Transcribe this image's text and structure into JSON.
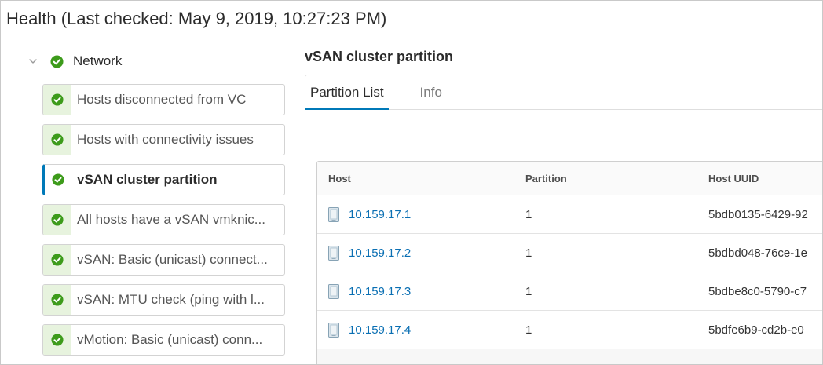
{
  "header": {
    "title": "Health (Last checked: May 9, 2019, 10:27:23 PM)"
  },
  "colors": {
    "accent": "#0079b8",
    "success": "#3d9b1b",
    "success_bg": "#e7f3de",
    "link": "#0a6fb3"
  },
  "tree": {
    "group": {
      "label": "Network",
      "expanded": true,
      "expand_icon": "chevron-down-icon",
      "status_icon": "check-circle-icon"
    },
    "items": [
      {
        "label": "Hosts disconnected from VC",
        "status_icon": "check-circle-icon",
        "selected": false
      },
      {
        "label": "Hosts with connectivity issues",
        "status_icon": "check-circle-icon",
        "selected": false
      },
      {
        "label": "vSAN cluster partition",
        "status_icon": "check-circle-icon",
        "selected": true
      },
      {
        "label": "All hosts have a vSAN vmknic...",
        "status_icon": "check-circle-icon",
        "selected": false
      },
      {
        "label": "vSAN: Basic (unicast) connect...",
        "status_icon": "check-circle-icon",
        "selected": false
      },
      {
        "label": "vSAN: MTU check (ping with l...",
        "status_icon": "check-circle-icon",
        "selected": false
      },
      {
        "label": "vMotion: Basic (unicast) conn...",
        "status_icon": "check-circle-icon",
        "selected": false
      }
    ]
  },
  "detail": {
    "title": "vSAN cluster partition",
    "tabs": [
      {
        "label": "Partition List",
        "active": true
      },
      {
        "label": "Info",
        "active": false
      }
    ],
    "table": {
      "columns": [
        "Host",
        "Partition",
        "Host UUID"
      ],
      "host_icon": "server-icon",
      "rows": [
        {
          "host": "10.159.17.1",
          "partition": "1",
          "host_uuid": "5bdb0135-6429-92"
        },
        {
          "host": "10.159.17.2",
          "partition": "1",
          "host_uuid": "5bdbd048-76ce-1e"
        },
        {
          "host": "10.159.17.3",
          "partition": "1",
          "host_uuid": "5bdbe8c0-5790-c7"
        },
        {
          "host": "10.159.17.4",
          "partition": "1",
          "host_uuid": "5bdfe6b9-cd2b-e0"
        }
      ]
    }
  }
}
